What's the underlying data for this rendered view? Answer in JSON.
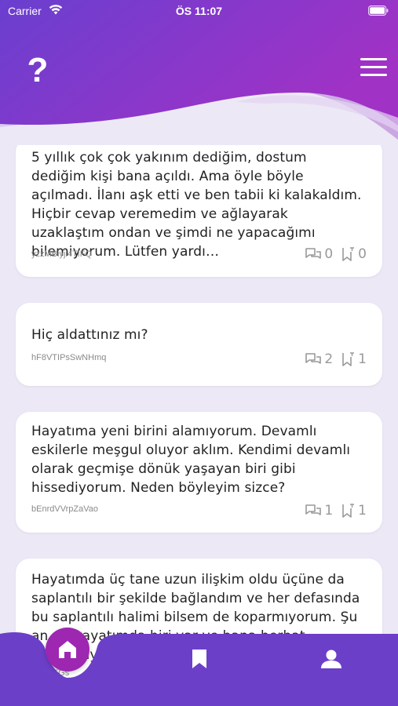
{
  "status_bar": {
    "carrier": "Carrier",
    "time": "ÖS 11:07"
  },
  "header": {
    "help_label": "?",
    "gradient_start": "#6a3fcf",
    "gradient_end": "#a032c6"
  },
  "posts": [
    {
      "text": "5 yıllık çok çok yakınım dediğim, dostum dediğim kişi bana açıldı. Ama öyle böyle açılmadı. İlanı aşk etti ve ben tabii ki kalakaldım. Hiçbir cevap veremedim ve ağlayarak uzaklaştım ondan ve şimdi ne yapacağımı bilemiyorum. Lütfen yardı…",
      "id": "yzzMBiyji4TIFQ",
      "comments": "0",
      "saves": "0"
    },
    {
      "text": "Hiç aldattınız mı?",
      "id": "hF8VTIPsSwNHmq",
      "comments": "2",
      "saves": "1"
    },
    {
      "text": "Hayatıma yeni birini alamıyorum. Devamlı eskilerle meşgul oluyor aklım. Kendimi devamlı olarak geçmişe dönük yaşayan biri gibi hissediyorum. Neden böyleyim sizce?",
      "id": "bEnrdVVrpZaVao",
      "comments": "1",
      "saves": "1"
    },
    {
      "text": "Hayatımda üç tane uzun ilişkim oldu üçüne da saplantılı bir şekilde bağlandım ve her defasında bu saplantılı halimi bilsem de koparmıyorum. Şu an da hayatımda biri var ve bana berbat hissettiriyor",
      "id": "V9HeFGs",
      "comments": "",
      "saves": ""
    }
  ],
  "tabbar": {
    "color": "#6c3fc8",
    "active_color": "#9d27b0",
    "icons": [
      "home-icon",
      "bookmark-icon",
      "profile-icon"
    ]
  }
}
